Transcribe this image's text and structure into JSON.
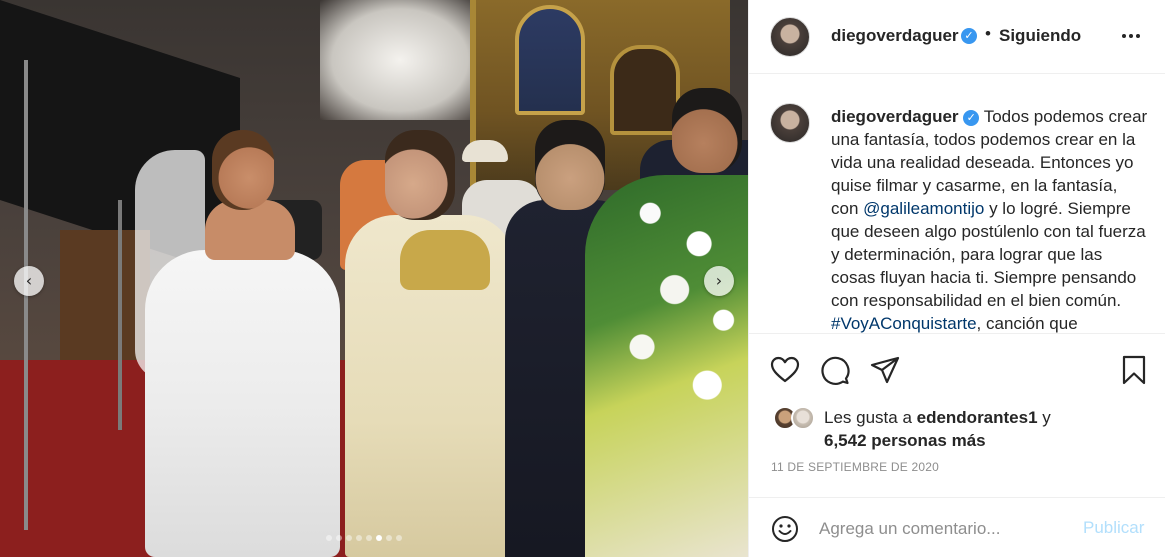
{
  "post": {
    "author": "diegoverdaguer",
    "follow_separator": "•",
    "follow_status": "Siguiendo",
    "verified_glyph": "✓",
    "caption": {
      "author": "diegoverdaguer",
      "text_1": "Todos podemos crear una fantasía, todos podemos crear en la vida una realidad deseada. Entonces yo quise filmar y casarme, en la fantasía, con ",
      "mention": "@galileamontijo",
      "text_2": " y lo logré. Siempre que deseen algo postúlenlo con tal fuerza y determinación, para lograr que las cosas fluyan hacia ti. Siempre pensando con responsabilidad en el bien común. ",
      "hashtag": "#VoyAConquistarte",
      "text_3": ", canción que"
    },
    "likes": {
      "prefix": "Les gusta a ",
      "user": "edendorantes1",
      "mid": " y",
      "others": "6,542 personas más"
    },
    "date": "11 DE SEPTIEMBRE DE 2020",
    "comment": {
      "placeholder": "Agrega un comentario...",
      "publish_label": "Publicar"
    },
    "carousel": {
      "prev_glyph": "‹",
      "next_glyph": "›",
      "slide_count": 8,
      "active_index": 5
    }
  },
  "icons": {
    "more": "more-horizontal-icon",
    "like": "heart-icon",
    "comment": "comment-icon",
    "share": "paper-plane-icon",
    "save": "bookmark-icon",
    "emoji": "emoji-icon"
  },
  "colors": {
    "link": "#00376b",
    "verified": "#3897f0",
    "publish_disabled": "#b2dffc",
    "muted": "#8e8e8e"
  }
}
